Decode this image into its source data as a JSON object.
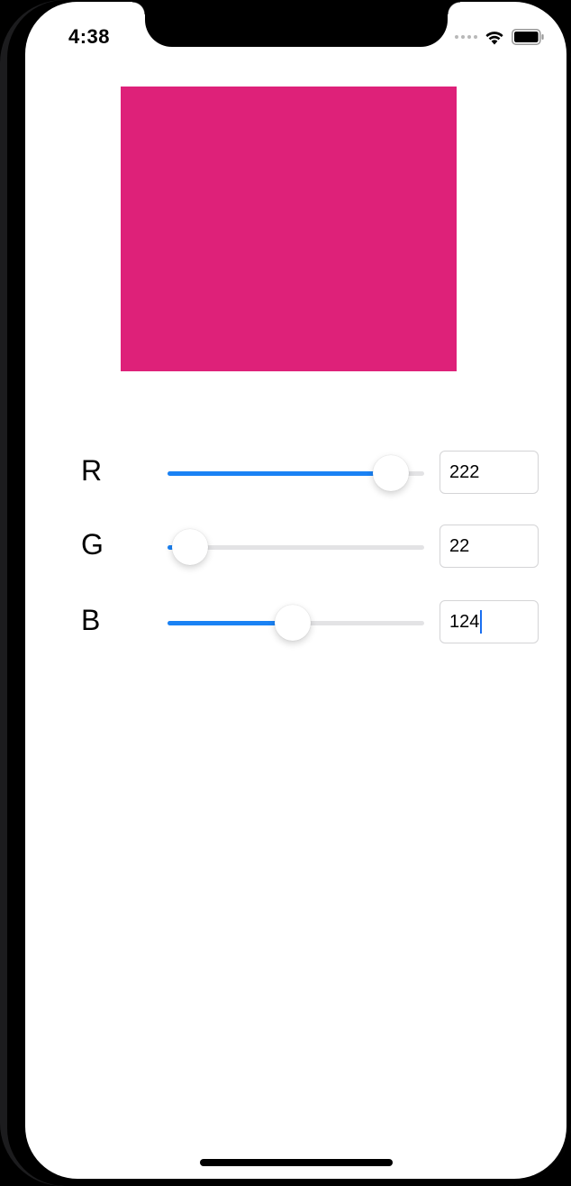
{
  "status_bar": {
    "time": "4:38",
    "icons": [
      "signal-dots-icon",
      "wifi-icon",
      "battery-icon"
    ]
  },
  "swatch": {
    "color": "#de2179"
  },
  "colors": {
    "accent": "#1a82f4",
    "track": "#e3e3e5"
  },
  "sliders": [
    {
      "label": "R",
      "value": "222",
      "fraction": 0.8706
    },
    {
      "label": "G",
      "value": "22",
      "fraction": 0.0863
    },
    {
      "label": "B",
      "value": "124",
      "fraction": 0.4863
    }
  ]
}
